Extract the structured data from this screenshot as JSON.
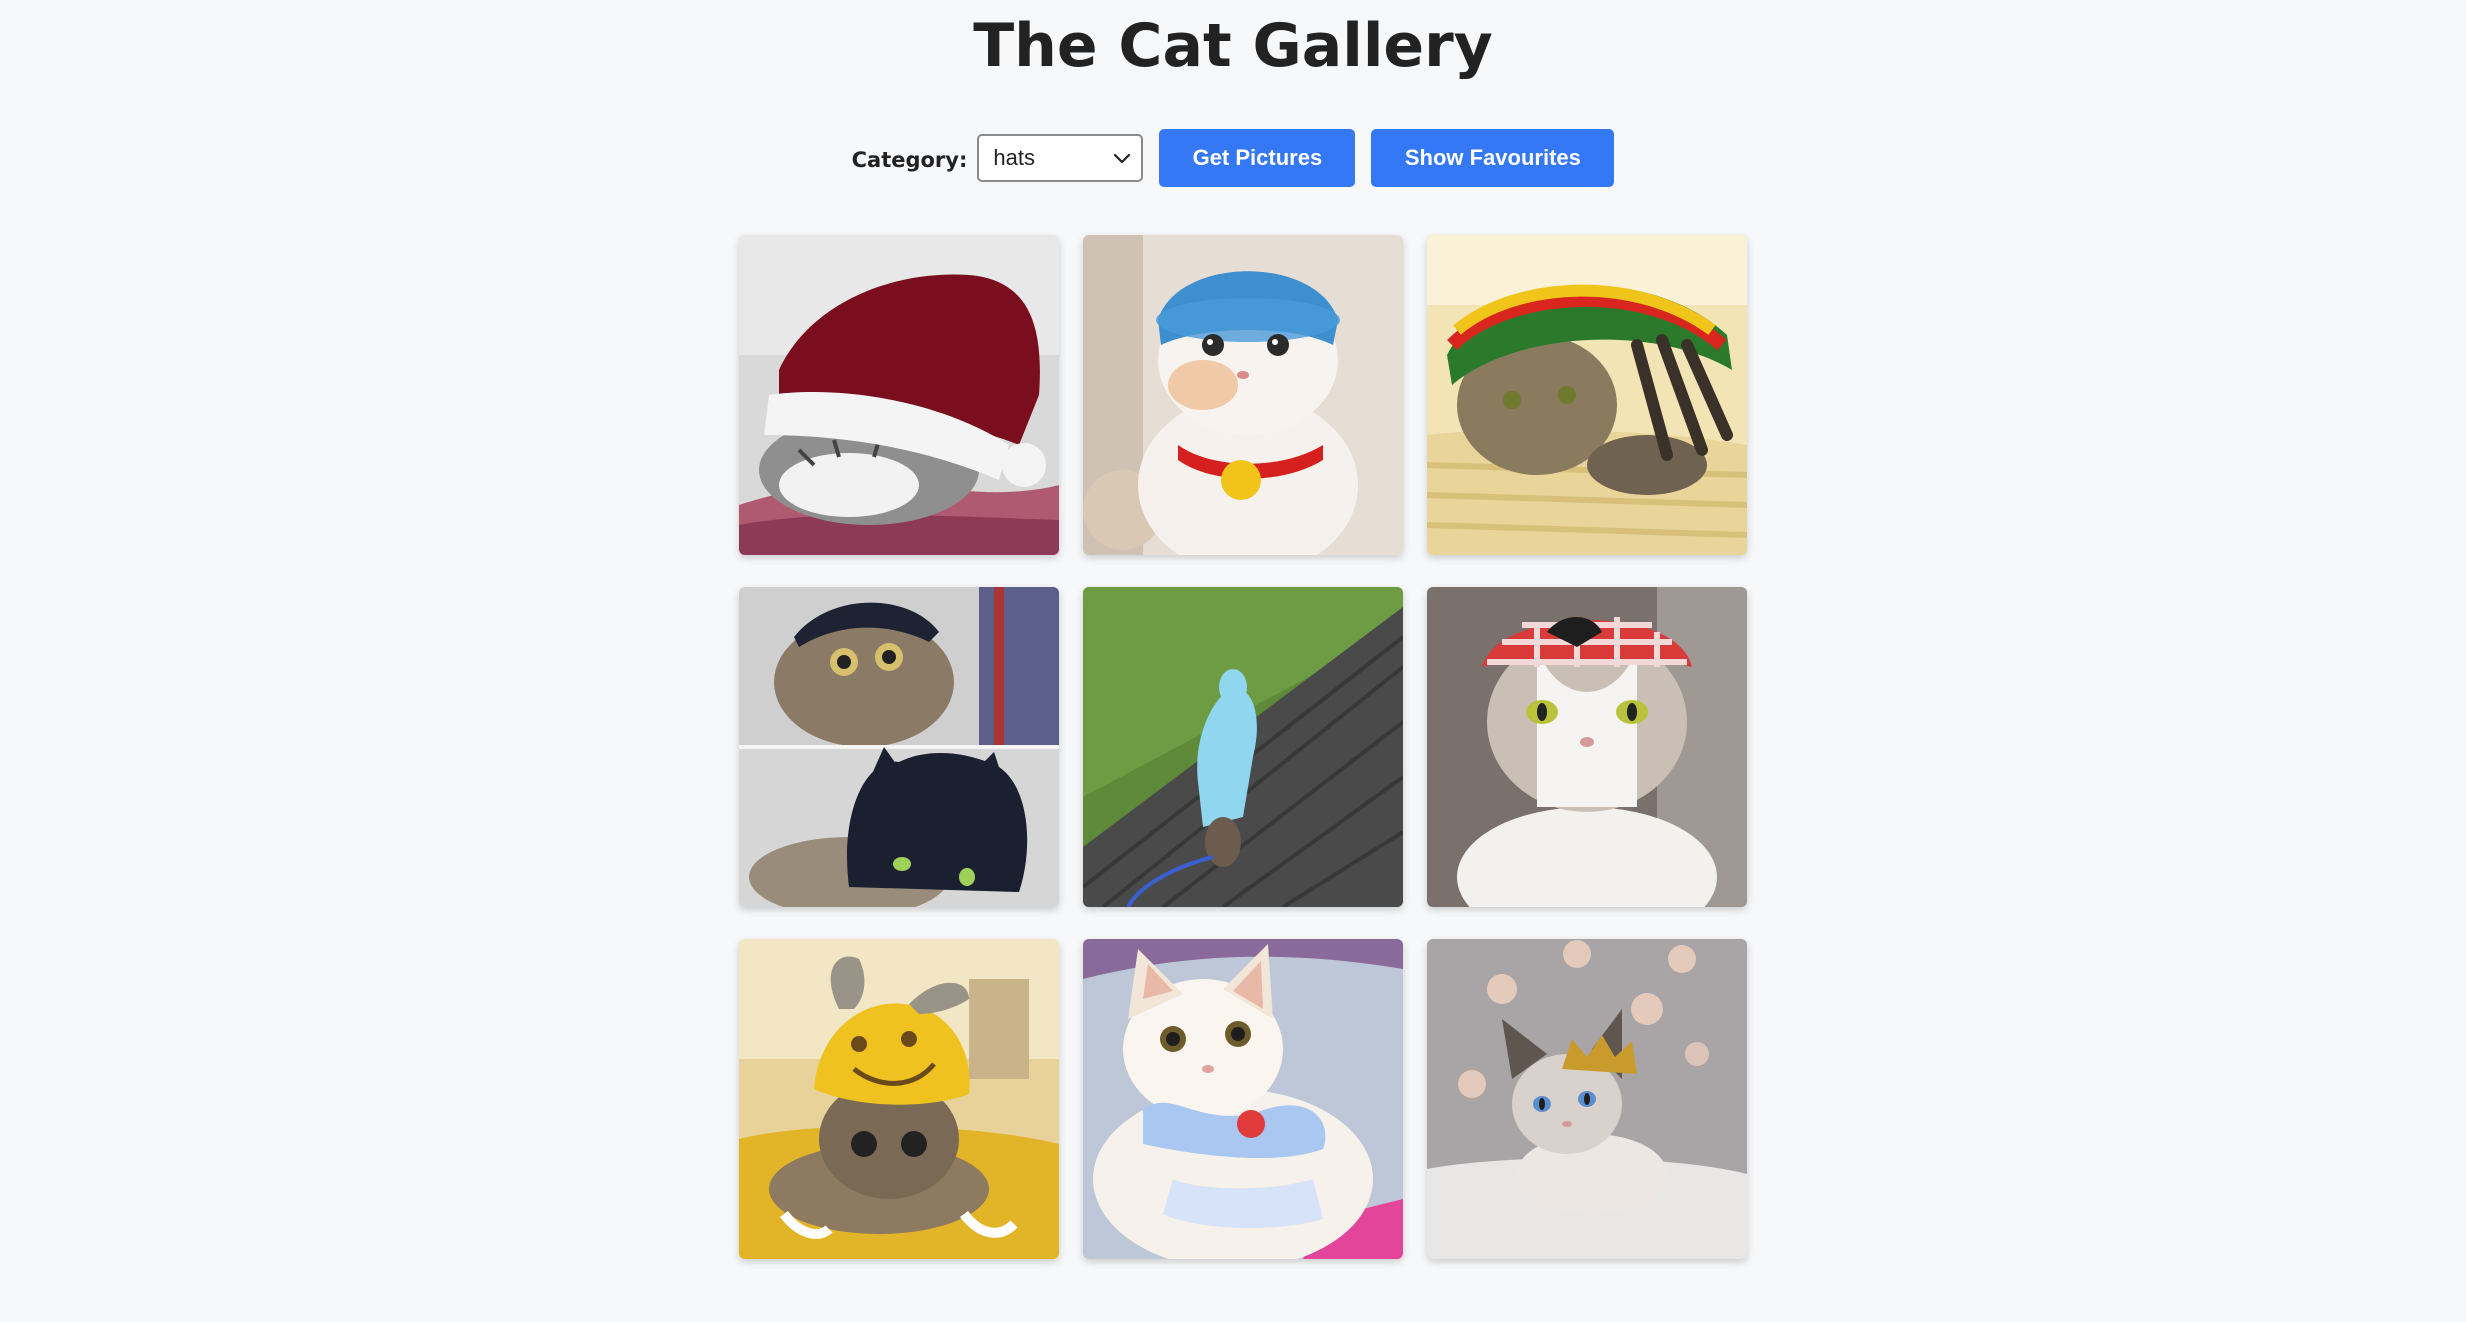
{
  "page": {
    "title": "The Cat Gallery"
  },
  "controls": {
    "category_label": "Category:",
    "category_selected": "hats",
    "get_pictures_label": "Get Pictures",
    "show_favourites_label": "Show Favourites"
  },
  "colors": {
    "accent": "#3478f6",
    "background": "#f7f8fa"
  },
  "gallery": {
    "images": [
      {
        "subject": "cat wearing a red Santa hat"
      },
      {
        "subject": "white cat wearing a blue knitted hat with a red collar and bell"
      },
      {
        "subject": "tabby cat under a rasta-striped knitted hat"
      },
      {
        "subject": "two photos of a cat wearing a dark knitted cat-ear hat"
      },
      {
        "subject": "cat in a light blue hooded coat on a wooden deck"
      },
      {
        "subject": "cat wearing a red gingham bonnet"
      },
      {
        "subject": "tabby cat wearing a yellow giraffe hat"
      },
      {
        "subject": "fluffy white kitten wearing a blue bow dress"
      },
      {
        "subject": "ragdoll kitten wearing a gold crown"
      }
    ]
  }
}
